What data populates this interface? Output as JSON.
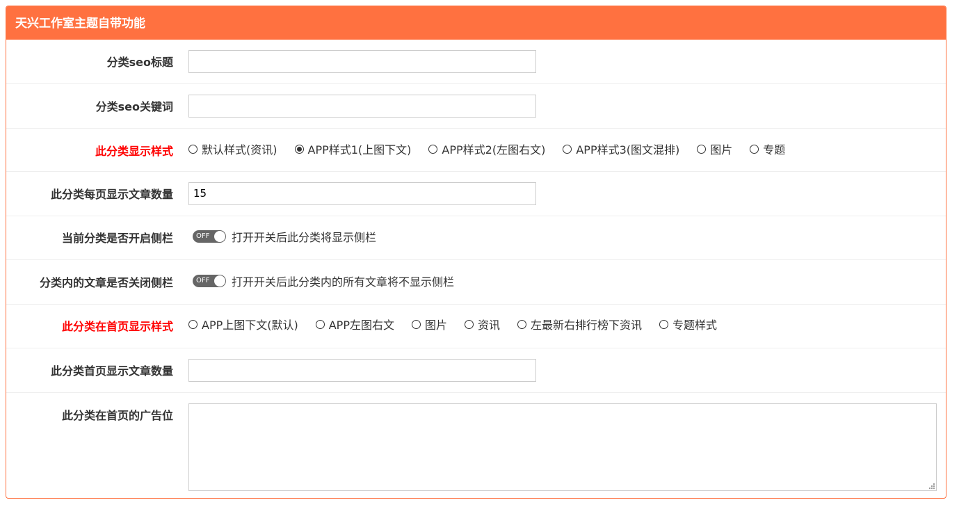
{
  "panel": {
    "title": "天兴工作室主题自带功能"
  },
  "colors": {
    "accent": "#ff7140",
    "required_label": "#ff0000"
  },
  "fields": {
    "seo_title": {
      "label": "分类seo标题",
      "value": ""
    },
    "seo_keywords": {
      "label": "分类seo关键词",
      "value": ""
    },
    "display_style": {
      "label": "此分类显示样式",
      "options": [
        "默认样式(资讯)",
        "APP样式1(上图下文)",
        "APP样式2(左图右文)",
        "APP样式3(图文混排)",
        "图片",
        "专题"
      ],
      "selected": "APP样式1(上图下文)"
    },
    "per_page": {
      "label": "此分类每页显示文章数量",
      "value": "15"
    },
    "sidebar_toggle": {
      "label": "当前分类是否开启侧栏",
      "state": "OFF",
      "description": "打开开关后此分类将显示侧栏"
    },
    "article_sidebar_toggle": {
      "label": "分类内的文章是否关闭侧栏",
      "state": "OFF",
      "description": "打开开关后此分类内的所有文章将不显示侧栏"
    },
    "home_style": {
      "label": "此分类在首页显示样式",
      "options": [
        "APP上图下文(默认)",
        "APP左图右文",
        "图片",
        "资讯",
        "左最新右排行榜下资讯",
        "专题样式"
      ],
      "selected": ""
    },
    "home_count": {
      "label": "此分类首页显示文章数量",
      "value": ""
    },
    "home_ad": {
      "label": "此分类在首页的广告位",
      "value": ""
    }
  }
}
